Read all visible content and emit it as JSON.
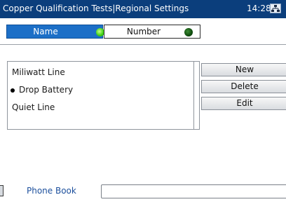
{
  "titlebar": {
    "title": "Copper Qualification Tests|Regional Settings",
    "time": "14:28",
    "status_icon": "network-status-icon"
  },
  "tabs": [
    {
      "label": "Name",
      "led_state": "active",
      "led_color": "#3fd216"
    },
    {
      "label": "Number",
      "led_state": "inactive",
      "led_color": "#0e4b0c"
    }
  ],
  "list": {
    "items": [
      {
        "label": "Miliwatt Line",
        "selected": false
      },
      {
        "label": "Drop Battery",
        "selected": true
      },
      {
        "label": "Quiet Line",
        "selected": false
      }
    ]
  },
  "buttons": {
    "new_label": "New",
    "delete_label": "Delete",
    "edit_label": "Edit"
  },
  "bottom": {
    "tab_label": "Phone Book"
  },
  "colors": {
    "titlebar_bg": "#0b3e7c",
    "active_tab_bg": "#1c6fc7",
    "accent_text": "#1c4f9c"
  }
}
